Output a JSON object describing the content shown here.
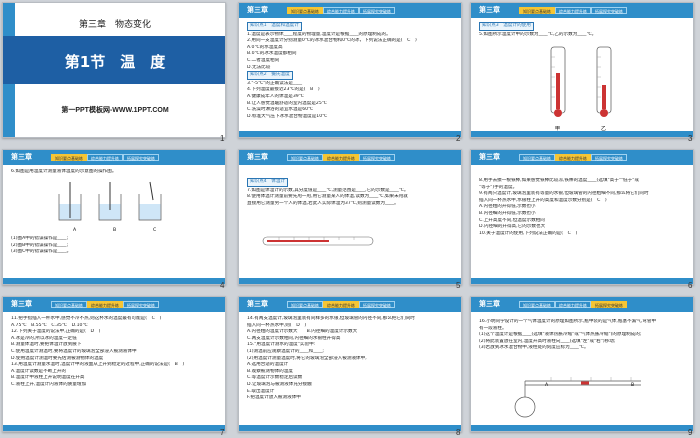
{
  "slides": [
    {
      "num": "1",
      "chapter": "第三章　物态变化",
      "section": "第1节　温　度",
      "site": "第一PPT模板网-WWW.1PPT.COM"
    },
    {
      "num": "2",
      "header": "第三章",
      "tabs": [
        "知识要点基础练",
        "综合能力提升练",
        "拓展探究突破练"
      ],
      "lines": [
        "知识点1　温度和温度计",
        "1.温度是表示物体____程度的物理量,温度计是根据____的原理制成的。",
        "2.用同一支温度计分别测量0℃的冰水混合物和0℃的冰，下列说法正确的是(　C　)",
        "A.0℃的水温度高",
        "B.0℃的冰水温度都相同",
        "C.二者温度相同",
        "D.无法比较",
        "知识点2　摄氏温度",
        "3.\"-5℃\"的正确读法是____",
        "4.下列温度最接近23℃的是(　B　)",
        "A.健康成年人的体温是39℃",
        "B.让人感觉温暖舒适的室内温度是25℃",
        "C.洗澡时淋浴的适宜水温是60℃",
        "D.标准大气压下冰水混合物温度是10℃"
      ]
    },
    {
      "num": "3",
      "header": "第三章",
      "tabs": [
        "知识要点基础练",
        "综合能力提升练",
        "拓展探究突破练"
      ],
      "lines": [
        "知识点3　温度计的使用",
        "5.如图所示温度计甲的示数为____℃,乙的示数为____℃。"
      ],
      "labels": [
        "甲",
        "乙"
      ]
    },
    {
      "num": "4",
      "header": "第三章",
      "tabs": [
        "知识要点基础练",
        "综合能力提升练",
        "拓展探究突破练"
      ],
      "lines": [
        "6.如图是用温度计测量液体温度的示意图的操作图。",
        "(1)图A中的错误操作是____;",
        "(2)图B中的错误操作是____;",
        "(3)图C中的错误操作是____。"
      ],
      "labels": [
        "A",
        "B",
        "C"
      ]
    },
    {
      "num": "5",
      "header": "第三章",
      "tabs": [
        "知识要点基础练",
        "综合能力提升练",
        "拓展探究突破练"
      ],
      "lines": [
        "知识点4　体温计",
        "7.如图是体温计的示数,其分度值是____℃,测量范围是____,它的示数是____℃。",
        "8.使用体温计测量前要先甩一甩,用它测量某人的体温,读数为____℃,如果未甩就",
        "直接用它测量另一个人的体温,若此人实际体温为37℃,则测量读数为____。"
      ]
    },
    {
      "num": "6",
      "header": "第三章",
      "tabs": [
        "知识要点基础练",
        "综合能力提升练",
        "拓展探究突破练"
      ],
      "lines": [
        "8.用手去摸一根铁棒,如果感觉铁棒比较凉,铁棒的温度____(选填\"高于\"\"低于\"或",
        "\"等于\")手的温度。",
        "9.有两只温度计,玻璃泡里装有等量的水银,但玻璃管的内径粗细不同,那么将它们同时",
        "插入同一杯热水中,水银柱上升的高度和温度示数分别是(　C　)",
        "A.内径粗的升得低,示数也小",
        "B.内径细的升得低,示数也小",
        "C.上升高度不同,但温度示数相同",
        "D.内径细的升得高,它的示数也大",
        "10.关于温度计的使用,下列说法正确的是(　C　)"
      ]
    },
    {
      "num": "7",
      "header": "第三章",
      "tabs": [
        "知识要点基础练",
        "综合能力提升练",
        "拓展探究突破练"
      ],
      "lines": [
        "11.把手指插入一杯水中,感觉不冷不热,则这杯水的温度最有可能是(　C　)",
        "A.75℃　B.55℃　C.35℃　D.10℃",
        "12.下列关于温度的说法中,正确的是(　D　)",
        "A.冰是冷的,所以冰的温度一定低",
        "B.测量体温时,要把体温计放到腋下",
        "C.使用温度计测温时,要将温度计的玻璃泡全部浸入被测液体中",
        "D.使用温度计测温时要先估测被测物体的温度",
        "13.用温度计测量水温时,温度计中的液面从上升到稳定的过程中,正确的说法是(　B　)",
        "A.温度计读数是不断上升的",
        "B.温度计中液柱上升说明温度在升高",
        "C.液柱上升,温度计内液体的质量增加"
      ]
    },
    {
      "num": "8",
      "header": "第三章",
      "tabs": [
        "知识要点基础练",
        "综合能力提升练",
        "拓展探究突破练"
      ],
      "lines": [
        "14.有两支温度计,玻璃泡里装有同样多的水银,但玻璃管的内径不同,那么把它们同时",
        "插入同一杯热水中,则(　D　)",
        "A.内径粗的温度计示数大　　B.内径细的温度计示数大",
        "C.两支温度计示数相同,内径细的水银柱升得高",
        "15.\"用温度计测水的温度\"实验中:",
        "(1)测温前应观察温度计的____和____;",
        "(2)用温度计测量温度时,将它的玻璃泡全部浸入被测液体中,",
        "A.选用合适的温度计",
        "B.观察被测物体的温度",
        "C.等温度计示数稳定后读数",
        "D.让玻璃泡与被测液体充分接触",
        "E.取出温度计",
        "F.把温度计放入被测液体中"
      ]
    },
    {
      "num": "9",
      "header": "第三章",
      "tabs": [
        "知识要点基础练",
        "综合能力提升练",
        "拓展探究突破练"
      ],
      "lines": [
        "16.小明同学设计的一个气体温度计的原理如图所示,瓶中装的是气体,瓶塞不漏气,弯管中",
        "有一段液柱。",
        "(1)这个温度计是根据____(选填\"液体热胀冷缩\"或\"气体热胀冷缩\")的原理制成的;",
        "(2)将此装置放在室内,温度升高时液柱向____(选填\"左\"或\"右\")移动;",
        "(3)若放到冰水混合物中,液柱处的刻度应标为____℃。"
      ],
      "labels": [
        "A",
        "B"
      ]
    }
  ]
}
